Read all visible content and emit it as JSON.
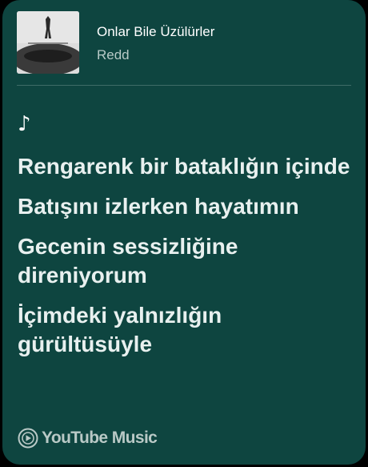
{
  "colors": {
    "card_background": "#0e4540",
    "primary_text": "#ffffff",
    "secondary_text": "#b8cac7",
    "divider": "#3f6c67"
  },
  "track": {
    "title": "Onlar Bile Üzülürler",
    "artist": "Redd"
  },
  "album_art": {
    "icon": "album-cover-image"
  },
  "lyrics": {
    "note_icon": "♪",
    "lines": [
      "Rengarenk bir bataklığın içinde",
      "Batışını izlerken hayatımın",
      "Gecenin sessizliğine direniyorum",
      "İçimdeki yalnızlığın gürültüsüyle"
    ]
  },
  "source": {
    "label": "YouTube Music",
    "icon": "youtube-music-logo-icon"
  }
}
